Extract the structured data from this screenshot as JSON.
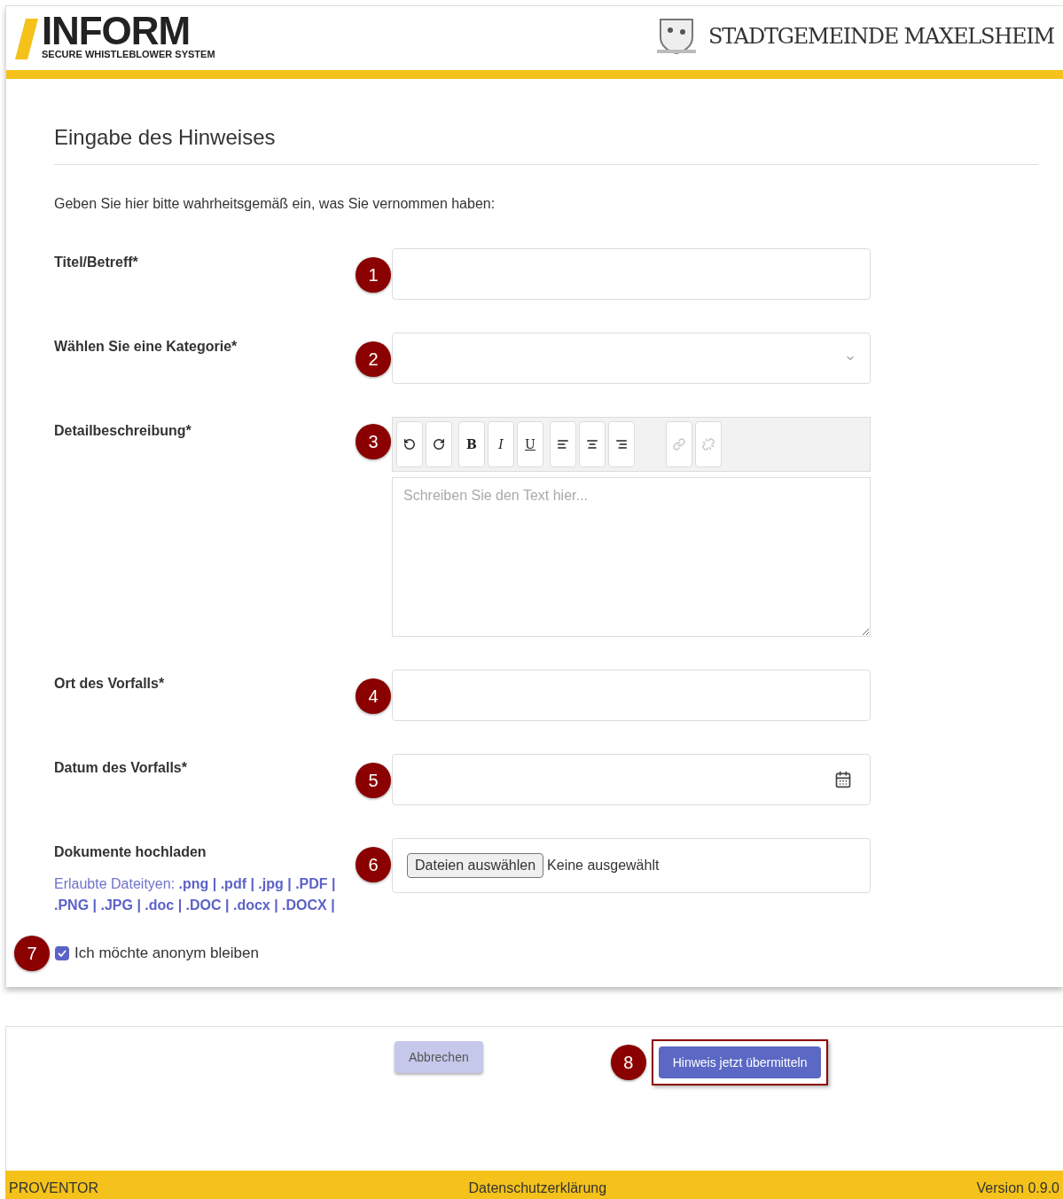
{
  "header": {
    "logo_text": "INFORM",
    "logo_subtitle": "SECURE WHISTLEBLOWER SYSTEM",
    "organization": "STADTGEMEINDE MAXELSHEIM"
  },
  "form": {
    "title": "Eingabe des Hinweises",
    "intro": "Geben Sie hier bitte wahrheitsgemäß ein, was Sie vernommen haben:",
    "fields": [
      {
        "kind": "text",
        "label": "Titel/Betreff*",
        "marker": "1"
      },
      {
        "kind": "select",
        "label": "Wählen Sie eine Kategorie*",
        "marker": "2"
      },
      {
        "kind": "editor",
        "label": "Detailbeschreibung*",
        "marker": "3",
        "placeholder": "Schreiben Sie den Text hier...",
        "toolbar": [
          [
            {
              "kind": "undo",
              "disabled": false
            },
            {
              "kind": "redo",
              "disabled": false
            }
          ],
          [
            {
              "kind": "bold",
              "text": "B",
              "disabled": false
            },
            {
              "kind": "italic",
              "text": "I",
              "disabled": false
            },
            {
              "kind": "underline",
              "text": "U",
              "disabled": false
            }
          ],
          [
            {
              "kind": "align-left",
              "disabled": false
            },
            {
              "kind": "align-center",
              "disabled": false
            },
            {
              "kind": "align-right",
              "disabled": false
            }
          ],
          [
            {
              "kind": "link",
              "disabled": true
            },
            {
              "kind": "unlink",
              "disabled": true
            }
          ]
        ]
      },
      {
        "kind": "text",
        "label": "Ort des Vorfalls*",
        "marker": "4"
      },
      {
        "kind": "date",
        "label": "Datum des Vorfalls*",
        "marker": "5"
      },
      {
        "kind": "file",
        "label": "Dokumente hochladen",
        "marker": "6",
        "button": "Dateien auswählen",
        "status": "Keine ausgewählt",
        "hint": "Erlaubte Dateityen:",
        "types": ".png | .pdf | .jpg | .PDF | .PNG | .JPG | .doc | .DOC | .docx | .DOCX |"
      }
    ],
    "anonymous": {
      "label": "Ich möchte anonym bleiben",
      "checked": true,
      "marker": "7"
    }
  },
  "actions": {
    "cancel": "Abbrechen",
    "submit": "Hinweis jetzt übermitteln",
    "marker": "8"
  },
  "footer": {
    "left": "PROVENTOR",
    "center": "Datenschutzerklärung",
    "right": "Version 0.9.0"
  }
}
